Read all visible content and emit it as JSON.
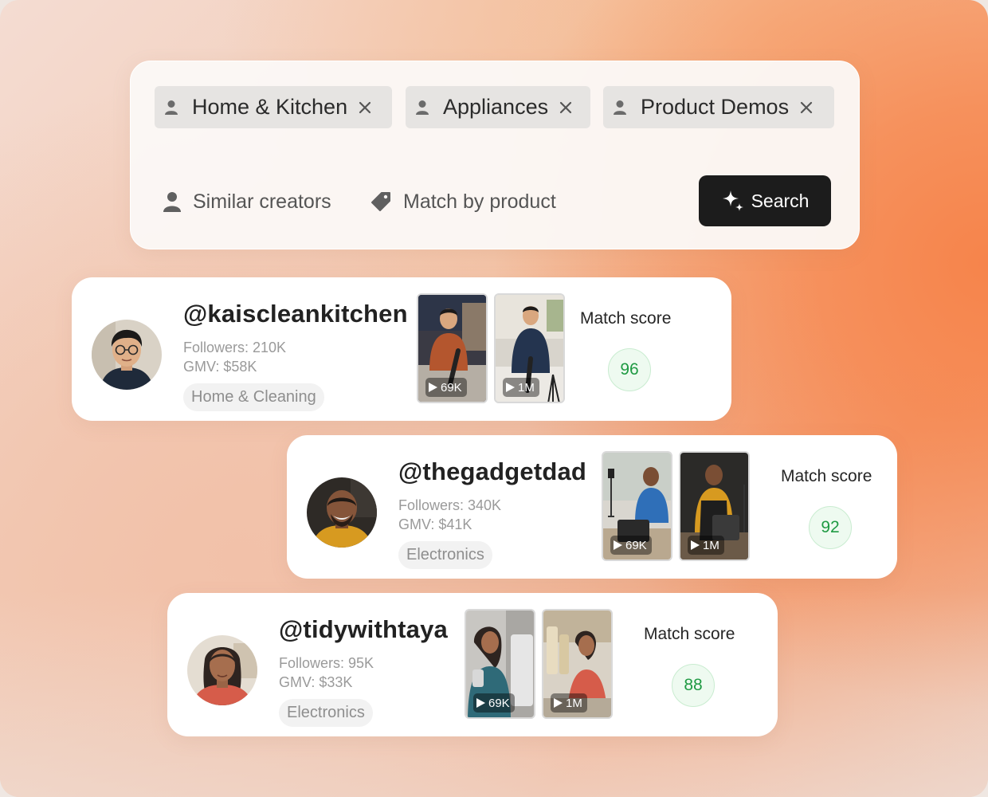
{
  "filters": {
    "chips": [
      {
        "label": "Home & Kitchen",
        "icon": "person-icon",
        "remove_icon": "close-icon"
      },
      {
        "label": "Appliances",
        "icon": "person-icon",
        "remove_icon": "close-icon"
      },
      {
        "label": "Product Demos",
        "icon": "person-icon",
        "remove_icon": "close-icon"
      }
    ],
    "options": [
      {
        "label": "Similar creators",
        "icon": "person-icon"
      },
      {
        "label": "Match by product",
        "icon": "tag-icon"
      }
    ],
    "search_button": {
      "label": "Search",
      "icon": "sparkle-icon"
    }
  },
  "creators": [
    {
      "handle": "@kaiscleankitchen",
      "followers": "Followers: 210K",
      "gmv": "GMV: $58K",
      "category": "Home & Cleaning",
      "videos": [
        {
          "views": "69K"
        },
        {
          "views": "1M"
        }
      ],
      "match_label": "Match score",
      "match_score": "96"
    },
    {
      "handle": "@thegadgetdad",
      "followers": "Followers: 340K",
      "gmv": "GMV: $41K",
      "category": "Electronics",
      "videos": [
        {
          "views": "69K"
        },
        {
          "views": "1M"
        }
      ],
      "match_label": "Match score",
      "match_score": "92"
    },
    {
      "handle": "@tidywithtaya",
      "followers": "Followers: 95K",
      "gmv": "GMV: $33K",
      "category": "Electronics",
      "videos": [
        {
          "views": "69K"
        },
        {
          "views": "1M"
        }
      ],
      "match_label": "Match score",
      "match_score": "88"
    }
  ],
  "colors": {
    "score_green": "#1f9a43",
    "search_button_bg": "#1c1c1c",
    "accent_orange": "#f6844b"
  }
}
